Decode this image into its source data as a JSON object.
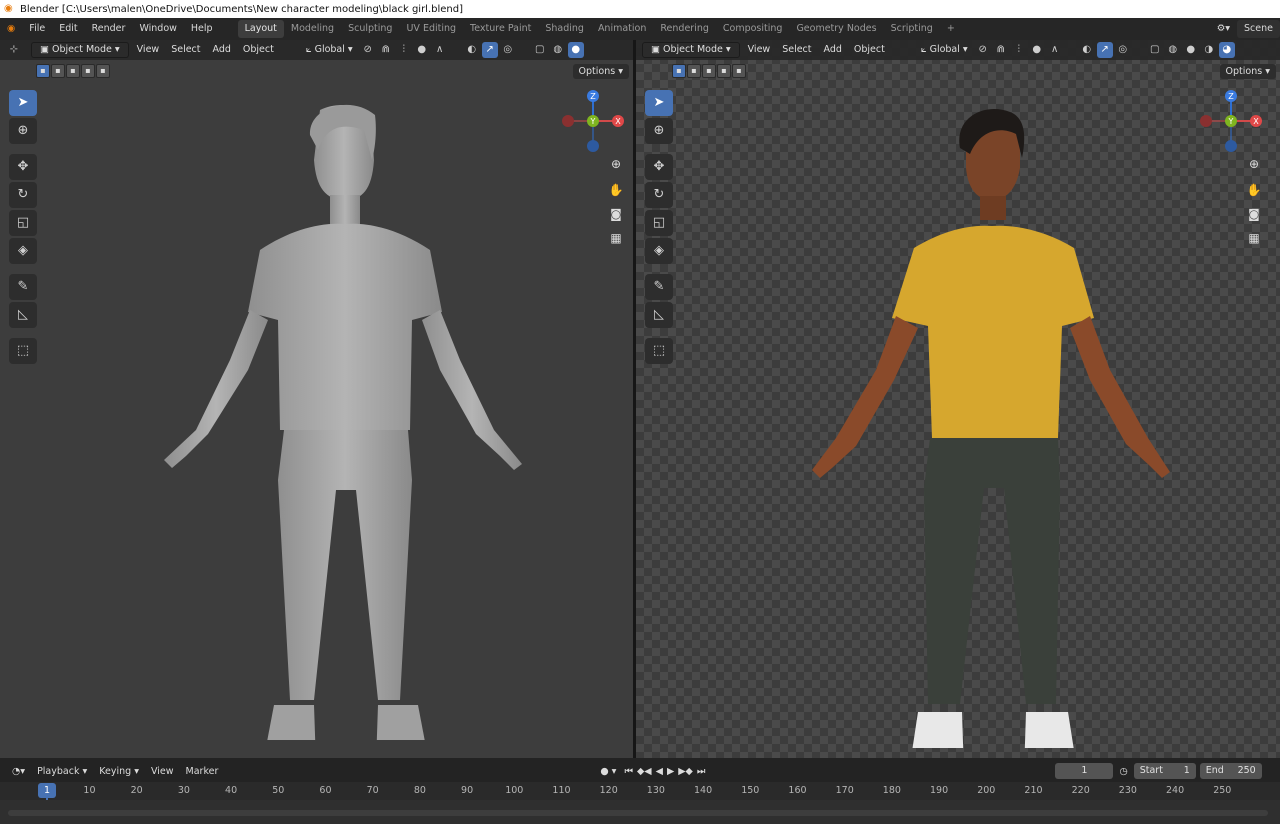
{
  "window": {
    "title": "Blender [C:\\Users\\malen\\OneDrive\\Documents\\New character modeling\\black girl.blend]"
  },
  "menu": [
    "File",
    "Edit",
    "Render",
    "Window",
    "Help"
  ],
  "workspaces": [
    "Layout",
    "Modeling",
    "Sculpting",
    "UV Editing",
    "Texture Paint",
    "Shading",
    "Animation",
    "Rendering",
    "Compositing",
    "Geometry Nodes",
    "Scripting"
  ],
  "active_workspace": "Layout",
  "scene_label": "Scene",
  "viewport_left": {
    "mode": "Object Mode",
    "menus": [
      "View",
      "Select",
      "Add",
      "Object"
    ],
    "orientation": "Global",
    "options_label": "Options",
    "shading": "solid"
  },
  "viewport_right": {
    "mode": "Object Mode",
    "menus": [
      "View",
      "Select",
      "Add",
      "Object"
    ],
    "orientation": "Global",
    "options_label": "Options",
    "shading": "rendered"
  },
  "gizmo": {
    "z": "Z",
    "y": "Y",
    "x": "X"
  },
  "timeline": {
    "menus": [
      "Playback",
      "Keying",
      "View",
      "Marker"
    ],
    "current_frame": "1",
    "start_label": "Start",
    "start_value": "1",
    "end_label": "End",
    "end_value": "250",
    "ruler_ticks": [
      "1",
      "10",
      "20",
      "30",
      "40",
      "50",
      "60",
      "70",
      "80",
      "90",
      "100",
      "110",
      "120",
      "130",
      "140",
      "150",
      "160",
      "170",
      "180",
      "190",
      "200",
      "210",
      "220",
      "230",
      "240",
      "250"
    ]
  },
  "colors": {
    "accent": "#4772b3",
    "shirt": "#d8a830",
    "pants": "#3a403a",
    "skin": "#8a4a2a",
    "clay": "#a6a6a6"
  }
}
